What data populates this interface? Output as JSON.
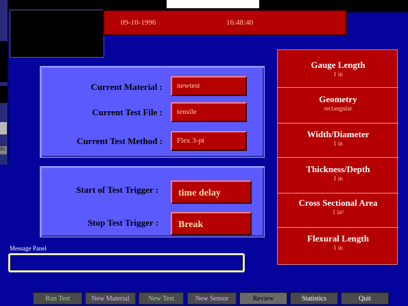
{
  "header": {
    "date": "09-10-1996",
    "time": "16:48:40"
  },
  "material_group": {
    "rows": [
      {
        "label": "Current Material :",
        "value": "newtest"
      },
      {
        "label": "Current Test File :",
        "value": "tensile"
      },
      {
        "label": "Current Test Method :",
        "value": "Flex 3-pt"
      }
    ]
  },
  "trigger_group": {
    "rows": [
      {
        "label": "Start of Test Trigger :",
        "value": "time delay"
      },
      {
        "label": "Stop Test Trigger :",
        "value": "Break"
      }
    ]
  },
  "specimen_panel": {
    "items": [
      {
        "title": "Gauge Length",
        "value": "1 in"
      },
      {
        "title": "Geometry",
        "value": "rectangular"
      },
      {
        "title": "Width/Diameter",
        "value": "1 in"
      },
      {
        "title": "Thickness/Depth",
        "value": "1 in"
      },
      {
        "title": "Cross Sectional Area",
        "value": "1 in²"
      },
      {
        "title": "Flexural Length",
        "value": "1 in"
      }
    ]
  },
  "message_panel": {
    "label": "Message Panel",
    "text": ""
  },
  "toolbar": {
    "buttons": [
      "Run Test",
      "New Material",
      "New Test",
      "New Sensor",
      "Review",
      "Statistics",
      "Quit"
    ]
  },
  "left_tab": {
    "label": "Ze"
  },
  "colors": {
    "background": "#04049c",
    "panel_red": "#b40000",
    "group_blue": "#5a5aff"
  }
}
